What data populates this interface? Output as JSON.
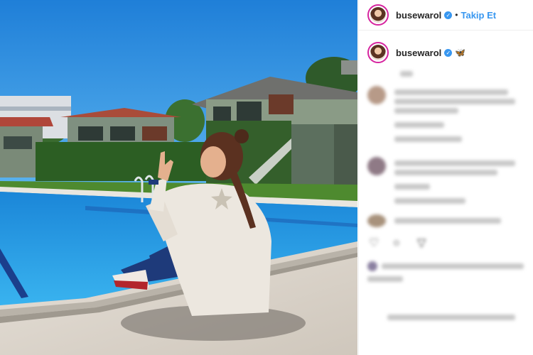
{
  "post": {
    "username": "busewarol",
    "verified_mark": "✓",
    "separator": "•",
    "follow_label": "Takip Et",
    "caption_emoji": "🦋",
    "photo_description_icon": "photo"
  },
  "icons": {
    "like": "heart-icon",
    "comment": "comment-icon",
    "share": "share-icon"
  },
  "colors": {
    "accent": "#3897f0",
    "pool": "#2fa3e4",
    "sky": "#2f8fe0"
  }
}
